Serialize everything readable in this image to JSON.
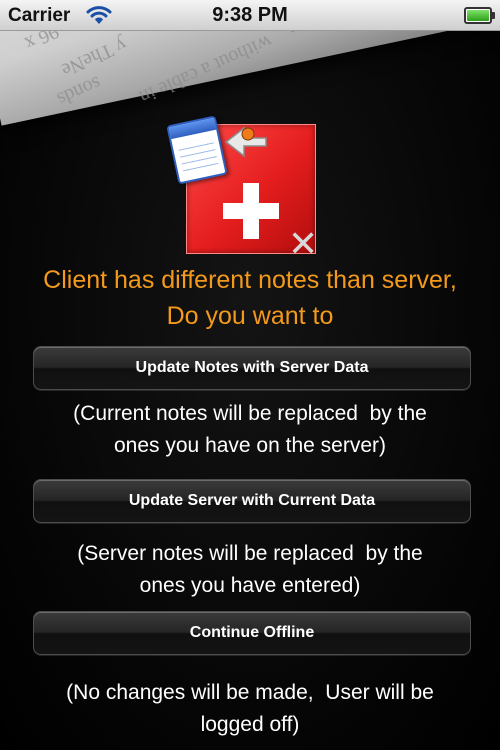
{
  "status_bar": {
    "carrier": "Carrier",
    "time": "9:38 PM",
    "battery_level": 1.0,
    "icons": [
      "wifi-icon",
      "battery-icon"
    ]
  },
  "background_paper": {
    "lines": [
      "96 x",
      "y TheNe",
      "sonds",
      "without a cable in",
      "ntion"
    ]
  },
  "app_icon": {
    "icons": [
      "calendar-icon",
      "arrow-icon",
      "plus-icon",
      "close-icon"
    ],
    "colors": {
      "red": "#e41d1d",
      "cross": "#ffffff",
      "x": "#d8d8d8"
    }
  },
  "message": {
    "line1": "Client has different notes than server,",
    "line2": "Do you want to",
    "color": "#f39a1c"
  },
  "options": {
    "update_notes": {
      "label": "Update Notes with Server Data",
      "desc_line1": "(Current notes will be replaced  by the",
      "desc_line2": "ones you have on the server)"
    },
    "update_server": {
      "label": "Update Server with Current Data",
      "desc_line1": "(Server notes will be replaced  by the",
      "desc_line2": "ones you have entered)"
    },
    "continue_offline": {
      "label": "Continue Offline",
      "desc_line1": "(No changes will be made,  User will be",
      "desc_line2": "logged off)"
    }
  }
}
